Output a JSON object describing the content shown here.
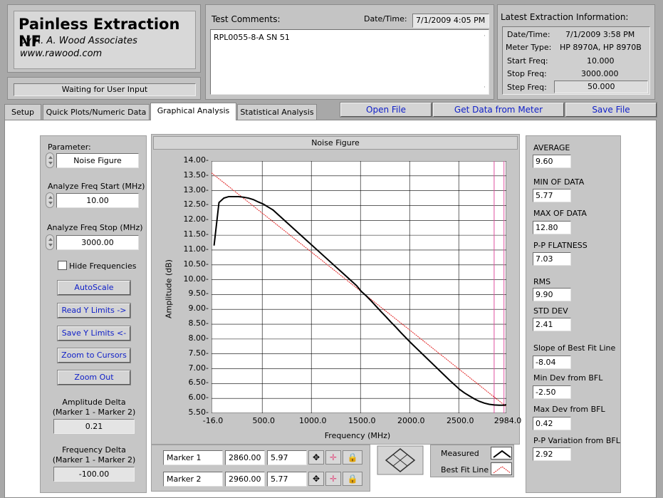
{
  "app": {
    "title": "Painless Extraction NF",
    "author": "by R. A. Wood Associates",
    "website": "www.rawood.com",
    "status": "Waiting for User Input"
  },
  "comments": {
    "label": "Test Comments:",
    "value": "RPL0055-8-A SN 51",
    "datetime_label": "Date/Time:",
    "datetime_value": "7/1/2009  4:05 PM"
  },
  "latest": {
    "title": "Latest Extraction Information:",
    "rows": [
      {
        "label": "Date/Time:",
        "value": "7/1/2009  3:58 PM"
      },
      {
        "label": "Meter Type:",
        "value": "HP 8970A, HP 8970B"
      },
      {
        "label": "Start Freq:",
        "value": "10.000"
      },
      {
        "label": "Stop Freq:",
        "value": "3000.000"
      },
      {
        "label": "Step Freq:",
        "value": "50.000"
      }
    ]
  },
  "tabs": [
    "Setup",
    "Quick Plots/Numeric Data",
    "Graphical Analysis",
    "Statistical Analysis"
  ],
  "toolbar": {
    "open": "Open File",
    "get": "Get Data from Meter",
    "save": "Save File"
  },
  "left": {
    "parameter_label": "Parameter:",
    "parameter_value": "Noise Figure",
    "start_label": "Analyze Freq Start (MHz)",
    "start_value": "10.00",
    "stop_label": "Analyze Freq Stop (MHz)",
    "stop_value": "3000.00",
    "hide_label": "Hide Frequencies",
    "buttons": [
      "AutoScale",
      "Read Y Limits ->",
      "Save Y Limits <-",
      "Zoom to Cursors",
      "Zoom Out"
    ],
    "amp_delta_label1": "Amplitude Delta",
    "amp_delta_label2": "(Marker 1 - Marker 2)",
    "amp_delta_value": "0.21",
    "freq_delta_label1": "Frequency Delta",
    "freq_delta_label2": "(Marker 1 - Marker 2)",
    "freq_delta_value": "-100.00"
  },
  "markers": [
    {
      "name": "Marker 1",
      "freq": "2860.00",
      "amp": "5.97"
    },
    {
      "name": "Marker 2",
      "freq": "2960.00",
      "amp": "5.77"
    }
  ],
  "legend": {
    "measured": "Measured",
    "bfl": "Best Fit Line"
  },
  "stats": [
    {
      "label": "AVERAGE",
      "value": "9.60"
    },
    {
      "label": "MIN OF DATA",
      "value": "5.77"
    },
    {
      "label": "MAX OF DATA",
      "value": "12.80"
    },
    {
      "label": "P-P FLATNESS",
      "value": "7.03"
    },
    {
      "label": "RMS",
      "value": "9.90"
    },
    {
      "label": "STD DEV",
      "value": "2.41"
    },
    {
      "label": "Slope of Best Fit Line",
      "value": "-8.04"
    },
    {
      "label": "Min Dev from BFL",
      "value": "-2.50"
    },
    {
      "label": "Max Dev from BFL",
      "value": "0.42"
    },
    {
      "label": "P-P Variation from BFL",
      "value": "2.92"
    }
  ],
  "colors": {
    "measured": "#000000",
    "bfl": "#e02020",
    "marker": "#e050a0",
    "link": "#1020c8"
  },
  "chart_data": {
    "type": "line",
    "title": "Noise Figure",
    "xlabel": "Frequency (MHz)",
    "ylabel": "Amplitude (dB)",
    "xlim": [
      -16,
      2984
    ],
    "ylim": [
      5.5,
      14.0
    ],
    "x_ticks": [
      "-16.0",
      "500.0",
      "1000.0",
      "1500.0",
      "2000.0",
      "2500.0",
      "2984.0"
    ],
    "x_tick_values": [
      -16,
      500,
      1000,
      1500,
      2000,
      2500,
      2984
    ],
    "y_ticks": [
      "14.00",
      "13.50",
      "13.00",
      "12.50",
      "12.00",
      "11.50",
      "11.00",
      "10.50",
      "10.00",
      "9.50",
      "9.00",
      "8.50",
      "8.00",
      "7.50",
      "7.00",
      "6.50",
      "6.00",
      "5.50"
    ],
    "grid": true,
    "markers_x": [
      2860,
      2960
    ],
    "series": [
      {
        "name": "Measured",
        "x": [
          10,
          60,
          110,
          160,
          210,
          260,
          310,
          360,
          410,
          460,
          510,
          560,
          610,
          660,
          710,
          760,
          810,
          860,
          910,
          960,
          1010,
          1060,
          1110,
          1160,
          1210,
          1260,
          1310,
          1360,
          1410,
          1460,
          1510,
          1560,
          1610,
          1660,
          1710,
          1760,
          1810,
          1860,
          1910,
          1960,
          2010,
          2060,
          2110,
          2160,
          2210,
          2260,
          2310,
          2360,
          2410,
          2460,
          2510,
          2560,
          2610,
          2660,
          2710,
          2760,
          2810,
          2860,
          2910,
          2960,
          3000
        ],
        "y": [
          11.15,
          12.6,
          12.75,
          12.8,
          12.8,
          12.8,
          12.78,
          12.75,
          12.7,
          12.62,
          12.55,
          12.45,
          12.35,
          12.2,
          12.05,
          11.9,
          11.75,
          11.6,
          11.45,
          11.3,
          11.15,
          11.0,
          10.85,
          10.7,
          10.55,
          10.4,
          10.25,
          10.1,
          9.95,
          9.8,
          9.6,
          9.45,
          9.28,
          9.1,
          8.92,
          8.75,
          8.57,
          8.4,
          8.22,
          8.05,
          7.88,
          7.72,
          7.56,
          7.4,
          7.24,
          7.08,
          6.92,
          6.76,
          6.6,
          6.45,
          6.3,
          6.18,
          6.08,
          5.98,
          5.9,
          5.84,
          5.8,
          5.78,
          5.77,
          5.77,
          5.8
        ]
      },
      {
        "name": "Best Fit Line",
        "x": [
          -16,
          3000
        ],
        "y": [
          13.6,
          5.68
        ]
      }
    ]
  }
}
